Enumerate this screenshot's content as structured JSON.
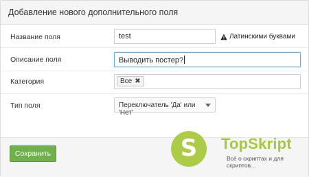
{
  "panel": {
    "title": "Добавление нового дополнительного поля"
  },
  "form": {
    "name": {
      "label": "Название поля",
      "value": "test",
      "hint": "Латинскими буквами",
      "hint_icon": "warning-icon"
    },
    "description": {
      "label": "Описание поля",
      "value": "Выводить постер?"
    },
    "category": {
      "label": "Категория",
      "tags": [
        {
          "label": "Все",
          "remove_icon": "close-icon"
        }
      ]
    },
    "field_type": {
      "label": "Тип поля",
      "selected": "Переключатель 'Да' или 'Нет'"
    }
  },
  "footer": {
    "save_label": "Сохранить"
  },
  "watermark": {
    "logo_letter": "S",
    "name": "TopSkript",
    "tagline": "Всё о скриптах и для скриптов..."
  },
  "colors": {
    "accent_green": "#6fb04c",
    "logo_green": "#a7c93b",
    "focus_blue": "#66afe9"
  }
}
